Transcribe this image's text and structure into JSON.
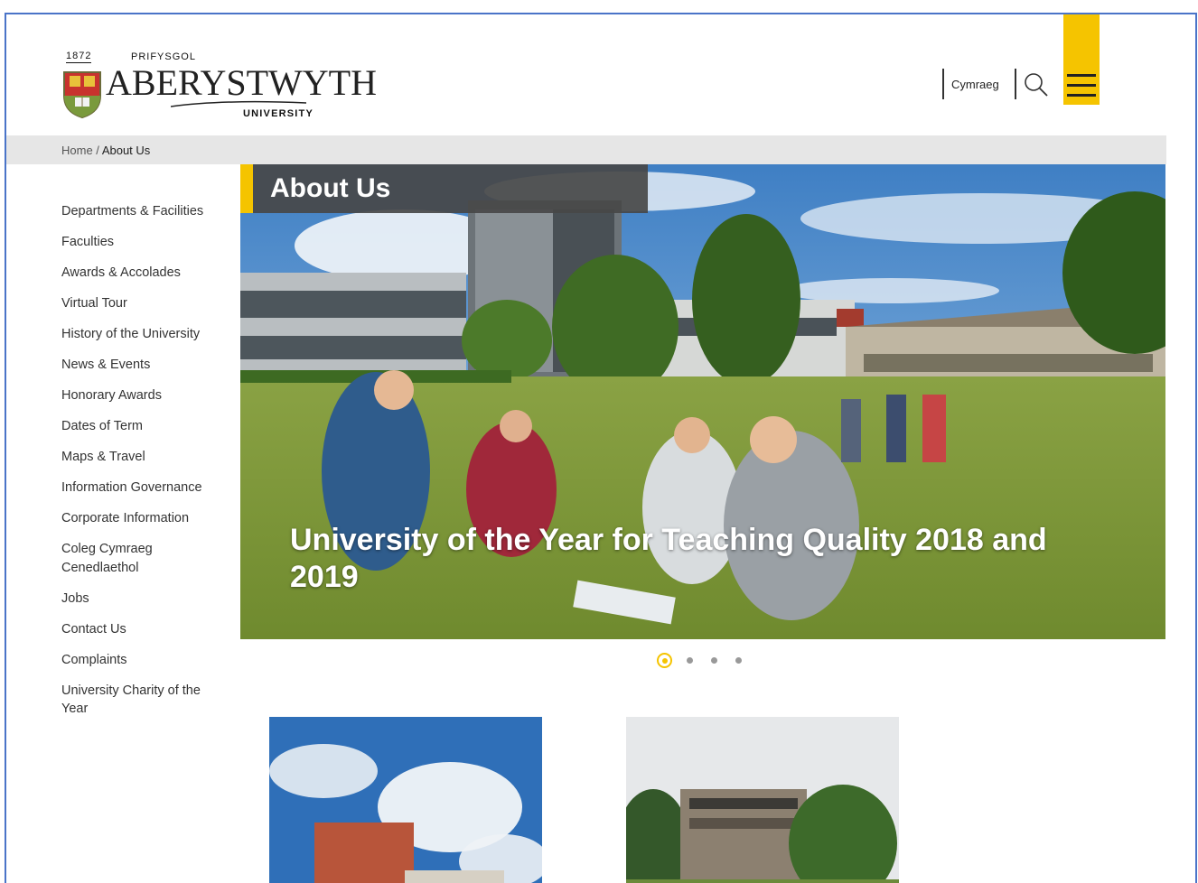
{
  "header": {
    "logo": {
      "year": "1872",
      "prifysgol": "PRIFYSGOL",
      "name": "ABERYSTWYTH",
      "university": "UNIVERSITY"
    },
    "language_link": "Cymraeg",
    "search_icon": "search-icon",
    "menu_icon": "hamburger-menu-icon"
  },
  "breadcrumb": {
    "home": "Home",
    "separator": " / ",
    "current": "About Us"
  },
  "sidebar": {
    "items": [
      {
        "label": "Departments & Facilities"
      },
      {
        "label": "Faculties"
      },
      {
        "label": "Awards & Accolades"
      },
      {
        "label": "Virtual Tour"
      },
      {
        "label": "History of the University"
      },
      {
        "label": "News & Events"
      },
      {
        "label": "Honorary Awards"
      },
      {
        "label": "Dates of Term"
      },
      {
        "label": "Maps & Travel"
      },
      {
        "label": "Information Governance"
      },
      {
        "label": "Corporate Information"
      },
      {
        "label": "Coleg Cymraeg Cenedlaethol"
      },
      {
        "label": "Jobs"
      },
      {
        "label": "Contact Us"
      },
      {
        "label": "Complaints"
      },
      {
        "label": "University Charity of the Year"
      }
    ]
  },
  "hero": {
    "title": "About Us",
    "caption": "University of the Year for Teaching Quality 2018 and 2019",
    "slides_count": 4,
    "active_slide": 1
  },
  "colors": {
    "accent": "#f5c400",
    "frame": "#4a74c8",
    "breadcrumb_bg": "#e6e6e6"
  }
}
